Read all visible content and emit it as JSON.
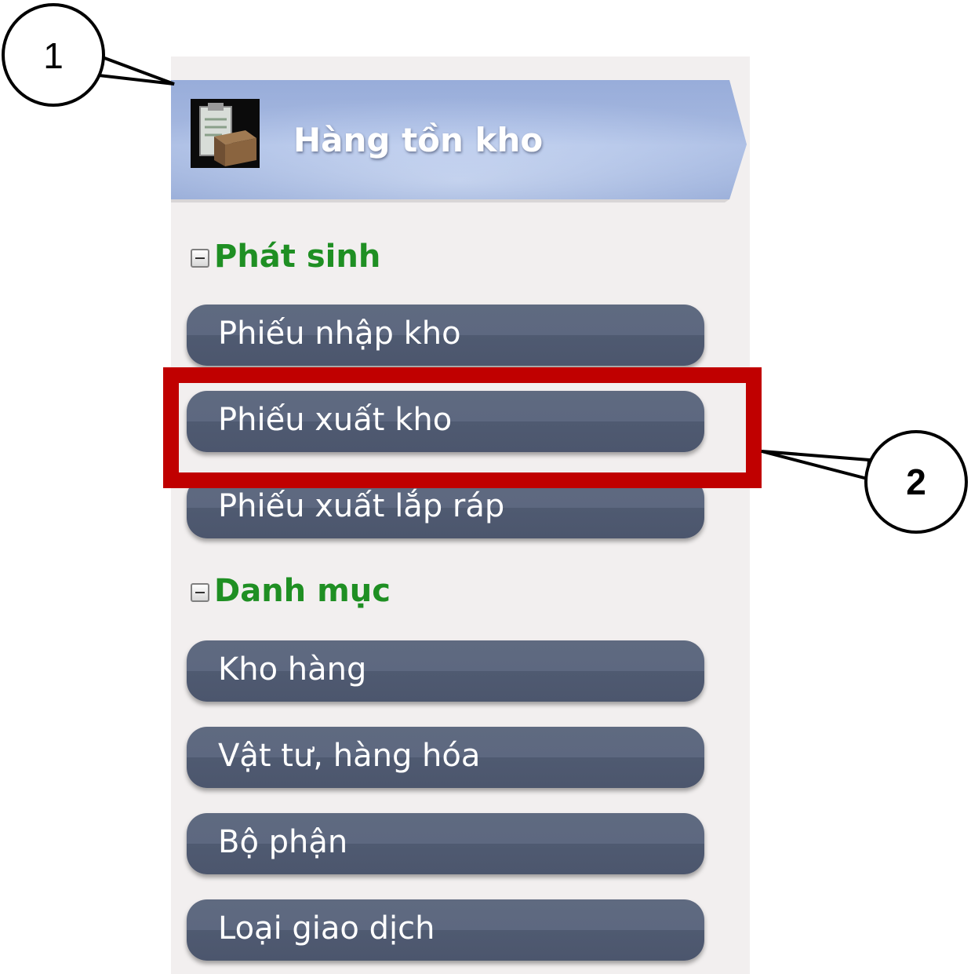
{
  "header": {
    "title": "Hàng tồn kho",
    "icon": "inventory-clipboard-box-icon",
    "banner_color": "#a9bde4"
  },
  "groups": [
    {
      "label": "Phát sinh",
      "icon": "collapse-minus-icon",
      "items": [
        {
          "label": "Phiếu nhập kho"
        },
        {
          "label": "Phiếu xuất kho"
        },
        {
          "label": "Phiếu xuất lắp ráp"
        }
      ]
    },
    {
      "label": "Danh mục",
      "icon": "collapse-minus-icon",
      "items": [
        {
          "label": "Kho hàng"
        },
        {
          "label": "Vật tư, hàng hóa"
        },
        {
          "label": "Bộ phận"
        },
        {
          "label": "Loại giao dịch"
        }
      ]
    }
  ],
  "callouts": [
    {
      "number": "1"
    },
    {
      "number": "2"
    }
  ],
  "colors": {
    "group_label": "#1f8f23",
    "button": "#56617a",
    "highlight": "#c00000",
    "panel": "#f2efef"
  }
}
